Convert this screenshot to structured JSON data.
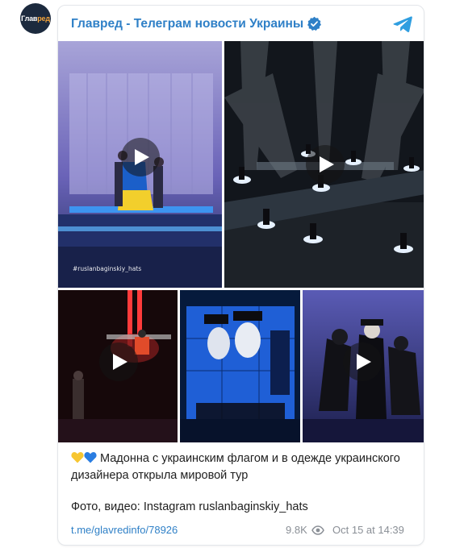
{
  "channel": {
    "avatar_text_main": "Глав",
    "avatar_text_accent": "ред",
    "name": "Главред - Телеграм новости Украины"
  },
  "media": {
    "watermark": "#ruslanbaginskiy_hats",
    "items": [
      {
        "kind": "video",
        "icon": "play-icon"
      },
      {
        "kind": "video",
        "icon": "play-icon"
      },
      {
        "kind": "video",
        "icon": "play-icon"
      },
      {
        "kind": "photo"
      },
      {
        "kind": "video",
        "icon": "play-icon"
      }
    ]
  },
  "post": {
    "emoji": [
      "yellow-heart-icon",
      "blue-heart-icon"
    ],
    "caption": "Мадонна с украинским флагом и в одежде украинского дизайнера открыла мировой тур",
    "credit": "Фото, видео: Instagram ruslanbaginskiy_hats",
    "link": "t.me/glavredinfo/78926",
    "views": "9.8K",
    "timestamp": "Oct 15 at 14:39"
  },
  "colors": {
    "accent": "#2f80c7",
    "muted": "#8a8f96",
    "heart_yellow": "#f7c631",
    "heart_blue": "#2a7de1"
  }
}
